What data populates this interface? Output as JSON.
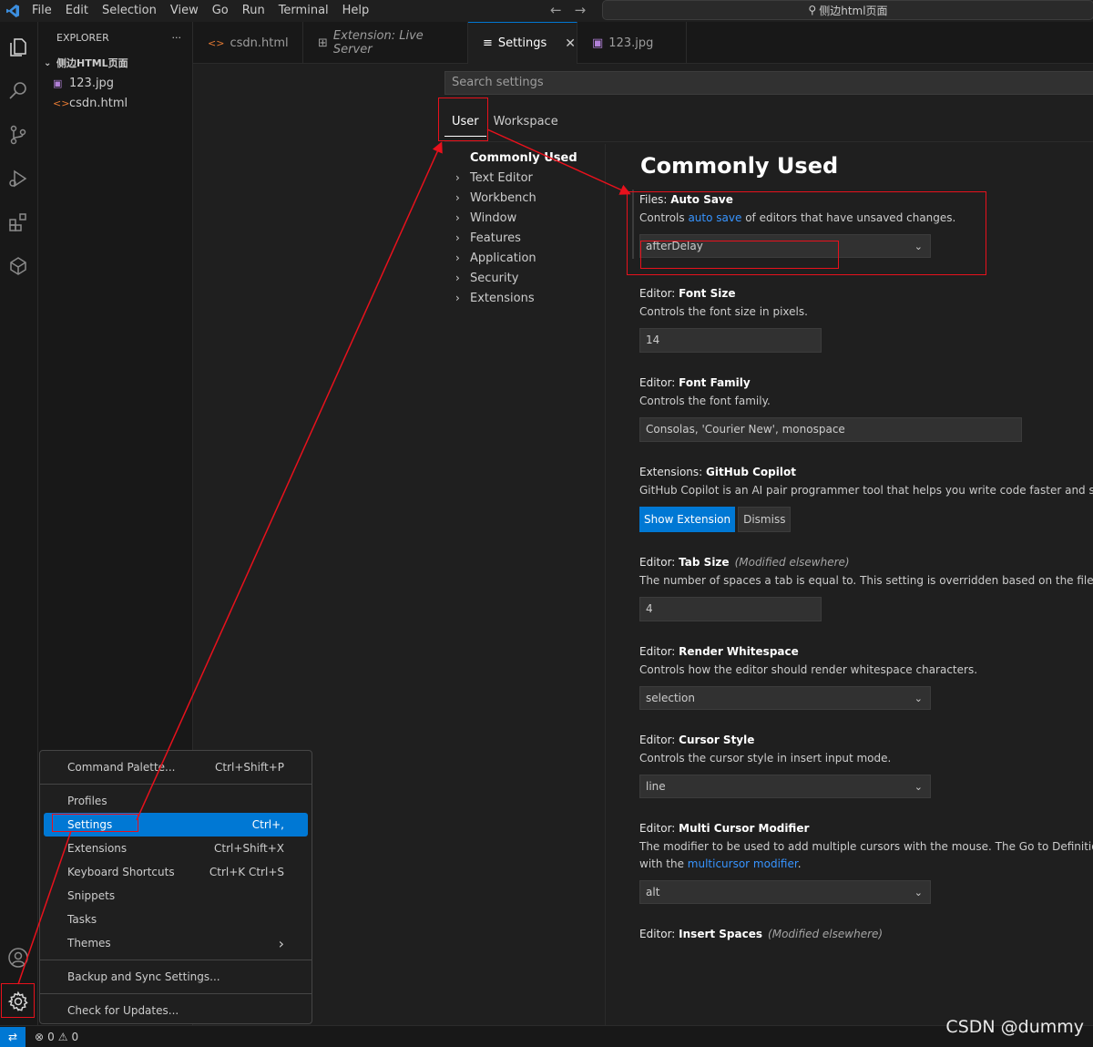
{
  "menubar": [
    "File",
    "Edit",
    "Selection",
    "View",
    "Go",
    "Run",
    "Terminal",
    "Help"
  ],
  "title_search": "侧边html页面",
  "explorer": {
    "header": "EXPLORER",
    "more": "···",
    "folder": "侧边HTML页面",
    "files": [
      "123.jpg",
      "csdn.html"
    ]
  },
  "tabs": [
    {
      "label": "csdn.html",
      "icon": "<>"
    },
    {
      "label": "Extension: Live Server",
      "icon": "⊞"
    },
    {
      "label": "Settings",
      "icon": "≡"
    },
    {
      "label": "123.jpg",
      "icon": "▣"
    }
  ],
  "settings": {
    "search_placeholder": "Search settings",
    "scopes": [
      "User",
      "Workspace"
    ],
    "toc": [
      "Commonly Used",
      "Text Editor",
      "Workbench",
      "Window",
      "Features",
      "Application",
      "Security",
      "Extensions"
    ],
    "section_title": "Commonly Used",
    "items": {
      "autosave": {
        "category": "Files: ",
        "name": "Auto Save",
        "desc_pre": "Controls ",
        "desc_link": "auto save",
        "desc_post": " of editors that have unsaved changes.",
        "value": "afterDelay"
      },
      "fontsize": {
        "category": "Editor: ",
        "name": "Font Size",
        "desc": "Controls the font size in pixels.",
        "value": "14"
      },
      "fontfamily": {
        "category": "Editor: ",
        "name": "Font Family",
        "desc": "Controls the font family.",
        "value": "Consolas, 'Courier New', monospace"
      },
      "copilot": {
        "category": "Extensions: ",
        "name": "GitHub Copilot",
        "desc": "GitHub Copilot is an AI pair programmer tool that helps you write code faster and smar",
        "primary": "Show Extension",
        "secondary": "Dismiss"
      },
      "tabsize": {
        "category": "Editor: ",
        "name": "Tab Size",
        "modified": "(Modified elsewhere)",
        "desc": "The number of spaces a tab is equal to. This setting is overridden based on the file cont",
        "value": "4"
      },
      "whitespace": {
        "category": "Editor: ",
        "name": "Render Whitespace",
        "desc": "Controls how the editor should render whitespace characters.",
        "value": "selection"
      },
      "cursorstyle": {
        "category": "Editor: ",
        "name": "Cursor Style",
        "desc": "Controls the cursor style in insert input mode.",
        "value": "line"
      },
      "multicursor": {
        "category": "Editor: ",
        "name": "Multi Cursor Modifier",
        "desc_line1": "The modifier to be used to add multiple cursors with the mouse. The Go to Definition a",
        "desc_line2_pre": "with the ",
        "desc_line2_link": "multicursor modifier",
        "desc_line2_post": ".",
        "value": "alt"
      },
      "insertspaces": {
        "category": "Editor: ",
        "name": "Insert Spaces",
        "modified": "(Modified elsewhere)"
      }
    }
  },
  "context_menu": {
    "command_palette": {
      "label": "Command Palette...",
      "key": "Ctrl+Shift+P"
    },
    "profiles": {
      "label": "Profiles"
    },
    "settings": {
      "label": "Settings",
      "key": "Ctrl+,"
    },
    "extensions": {
      "label": "Extensions",
      "key": "Ctrl+Shift+X"
    },
    "keyboard": {
      "label": "Keyboard Shortcuts",
      "key": "Ctrl+K Ctrl+S"
    },
    "snippets": {
      "label": "Snippets"
    },
    "tasks": {
      "label": "Tasks"
    },
    "themes": {
      "label": "Themes",
      "arrow": "›"
    },
    "backup": {
      "label": "Backup and Sync Settings..."
    },
    "updates": {
      "label": "Check for Updates..."
    }
  },
  "statusbar": {
    "errors": "0",
    "warnings": "0"
  },
  "watermark": "CSDN @dummy",
  "colors": {
    "accent": "#0078d4",
    "annotation": "#e8111c",
    "link": "#3794ff"
  }
}
